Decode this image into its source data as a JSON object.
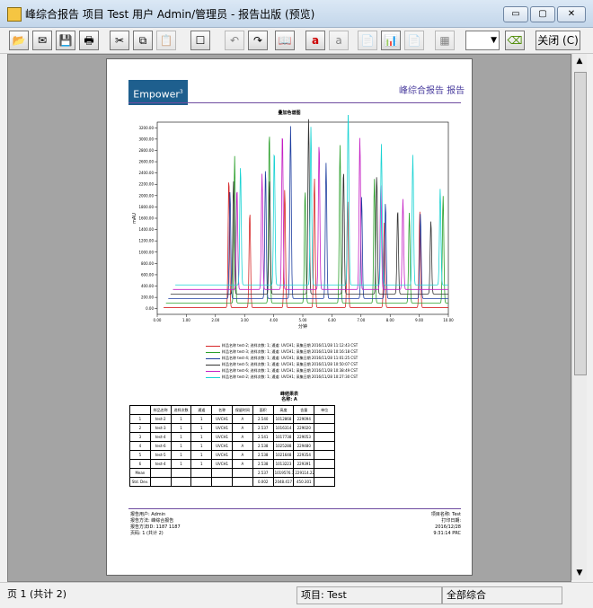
{
  "window": {
    "title": "峰综合报告 项目 Test 用户 Admin/管理员 - 报告出版 (预览)",
    "min_glyph": "▭",
    "max_glyph": "▢",
    "close_glyph": "✕"
  },
  "toolbar": {
    "buttons": [
      {
        "name": "open-icon",
        "glyph": "📂"
      },
      {
        "name": "email-icon",
        "glyph": "✉"
      },
      {
        "name": "save-icon",
        "glyph": "💾"
      },
      {
        "name": "print-icon",
        "glyph": "🖶"
      },
      {
        "name": "cut-icon",
        "glyph": "✂"
      },
      {
        "name": "copy-icon",
        "glyph": "⧉"
      },
      {
        "name": "paste-icon",
        "glyph": "📋"
      },
      {
        "name": "frame-icon",
        "glyph": "☐"
      },
      {
        "name": "undo-icon",
        "glyph": "↶"
      },
      {
        "name": "redo-icon",
        "glyph": "↷"
      },
      {
        "name": "book-icon",
        "glyph": "📖"
      },
      {
        "name": "text-icon",
        "glyph": "a"
      },
      {
        "name": "text-dim-icon",
        "glyph": "a"
      },
      {
        "name": "doc-icon",
        "glyph": "📄"
      },
      {
        "name": "chart-icon",
        "glyph": "📊"
      },
      {
        "name": "doc2-icon",
        "glyph": "📄"
      },
      {
        "name": "grid-icon",
        "glyph": "▦"
      }
    ],
    "dropdown_value": "",
    "dropdown_arrow": "▼",
    "eraser_glyph": "⌫",
    "close_label": "关闭 (C)"
  },
  "report": {
    "logo_text": "Empower",
    "logo_sup": "3",
    "title": "峰综合报告 报告",
    "chart_title": "叠加色谱图",
    "legend": [
      {
        "color": "#d62728",
        "label": "样品名称 test-2; 进样次数: 1; 通道: UVCH1; 采集日期 2016/11/28 11:12:43 CST"
      },
      {
        "color": "#2ca02c",
        "label": "样品名称 test-3; 进样次数: 1; 通道: UVCH1; 采集日期 2016/11/28 10:16:18 CST"
      },
      {
        "color": "#1f3fa0",
        "label": "样品名称 test-4; 进样次数: 1; 通道: UVCH1; 采集日期 2016/11/28 11:01:25 CST"
      },
      {
        "color": "#333333",
        "label": "样品名称 test-5; 进样次数: 1; 通道: UVCH1; 采集日期 2016/11/28 10:50:07 CST"
      },
      {
        "color": "#c41fc4",
        "label": "样品名称 test-6; 进样次数: 1; 通道: UVCH1; 采集日期 2016/11/28 10:38:49 CST"
      },
      {
        "color": "#19d3d3",
        "label": "样品名称 test-2; 进样次数: 1; 通道: UVCH1; 采集日期 2016/11/28 10:27:30 CST"
      }
    ],
    "table_title_1": "峰结果表",
    "table_title_2": "名称: A",
    "table_header": [
      "",
      "样品名称",
      "进样次数",
      "通道",
      "名称",
      "保留时间",
      "面积",
      "高度",
      "含量",
      "单位"
    ],
    "table_rows": [
      [
        "1",
        "test-2",
        "1",
        "1",
        "UVCH1",
        "A",
        "2.540",
        "1012868",
        "229094",
        "",
        ""
      ],
      [
        "2",
        "test-3",
        "1",
        "1",
        "UVCH1",
        "A",
        "2.537",
        "1016314",
        "229020",
        "",
        ""
      ],
      [
        "3",
        "test-4",
        "1",
        "1",
        "UVCH1",
        "A",
        "2.541",
        "1017738",
        "229053",
        "",
        ""
      ],
      [
        "4",
        "test-6",
        "1",
        "1",
        "UVCH1",
        "A",
        "2.538",
        "1025288",
        "229480",
        "",
        ""
      ],
      [
        "5",
        "test-5",
        "1",
        "1",
        "UVCH1",
        "A",
        "2.538",
        "1021648",
        "229354",
        "",
        ""
      ],
      [
        "6",
        "test-4",
        "1",
        "1",
        "UVCH1",
        "A",
        "2.538",
        "1013223",
        "229391",
        "",
        ""
      ],
      [
        "Mean",
        "",
        "",
        "",
        "",
        "",
        "2.537",
        "1019576.796",
        "229114.228",
        "",
        ""
      ],
      [
        "Std. Dev.",
        "",
        "",
        "",
        "",
        "",
        "0.002",
        "2048.417",
        "450.301",
        "",
        ""
      ]
    ],
    "footer": {
      "printed_by": "报告用户: Admin",
      "report_method": "报告方法: 峰综合报告",
      "report_method_id": "报告方法ID: 1187      1187",
      "page": "页码: 1 (共计 2)",
      "project": "项目名称: Test",
      "print_label": "打印日期:",
      "date": "2016/12/28",
      "time": "9:31:14 PRC"
    }
  },
  "chart_data": {
    "type": "line",
    "title": "叠加色谱图",
    "xlabel": "分钟",
    "ylabel": "mAU",
    "xlim": [
      0,
      10
    ],
    "ylim": [
      -100,
      3300
    ],
    "x_ticks": [
      "0.00",
      "1.00",
      "2.00",
      "3.00",
      "4.00",
      "5.00",
      "6.00",
      "7.00",
      "8.00",
      "9.00",
      "10.00"
    ],
    "y_ticks": [
      "0.00",
      "200.00",
      "400.00",
      "600.00",
      "800.00",
      "1000.00",
      "1200.00",
      "1400.00",
      "1600.00",
      "1800.00",
      "2000.00",
      "2200.00",
      "2400.00",
      "2600.00",
      "2800.00",
      "3000.00",
      "3200.00"
    ],
    "series": [
      {
        "color": "#d62728",
        "baseline": 20,
        "peaks": [
          [
            2.46,
            2300
          ],
          [
            3.18,
            1700
          ],
          [
            4.38,
            2100
          ],
          [
            5.4,
            2300
          ],
          [
            6.54,
            1900
          ],
          [
            7.8,
            1500
          ],
          [
            9.02,
            1700
          ]
        ]
      },
      {
        "color": "#2ca02c",
        "baseline": 100,
        "peaks": [
          [
            2.66,
            2600
          ],
          [
            3.85,
            3050
          ],
          [
            5.08,
            2000
          ],
          [
            6.28,
            2800
          ],
          [
            7.46,
            2200
          ],
          [
            8.66,
            1600
          ],
          [
            9.82,
            1900
          ]
        ]
      },
      {
        "color": "#1f3fa0",
        "baseline": 180,
        "peaks": [
          [
            2.5,
            1900
          ],
          [
            3.72,
            2300
          ],
          [
            4.58,
            3050
          ],
          [
            5.8,
            2400
          ],
          [
            7.02,
            1800
          ],
          [
            7.84,
            1700
          ],
          [
            9.04,
            1500
          ]
        ]
      },
      {
        "color": "#333333",
        "baseline": 260,
        "peaks": [
          [
            2.62,
            2000
          ],
          [
            3.86,
            2000
          ],
          [
            5.2,
            3100
          ],
          [
            6.4,
            2200
          ],
          [
            7.54,
            2100
          ],
          [
            8.26,
            1500
          ],
          [
            9.4,
            1300
          ]
        ]
      },
      {
        "color": "#c41fc4",
        "baseline": 340,
        "peaks": [
          [
            2.74,
            1800
          ],
          [
            3.6,
            2050
          ],
          [
            4.3,
            2800
          ],
          [
            5.56,
            2600
          ],
          [
            6.96,
            2700
          ],
          [
            7.68,
            1850
          ],
          [
            8.44,
            1600
          ]
        ]
      },
      {
        "color": "#19d3d3",
        "baseline": 420,
        "peaks": [
          [
            2.86,
            2100
          ],
          [
            4.02,
            2400
          ],
          [
            5.28,
            2800
          ],
          [
            6.56,
            3100
          ],
          [
            7.7,
            2500
          ],
          [
            8.78,
            2300
          ],
          [
            9.72,
            1700
          ]
        ]
      }
    ]
  },
  "status": {
    "page": "页 1 (共计 2)",
    "project": "项目: Test",
    "mode": "全部综合"
  },
  "scrollbar": {
    "up": "▲",
    "down": "▼"
  }
}
